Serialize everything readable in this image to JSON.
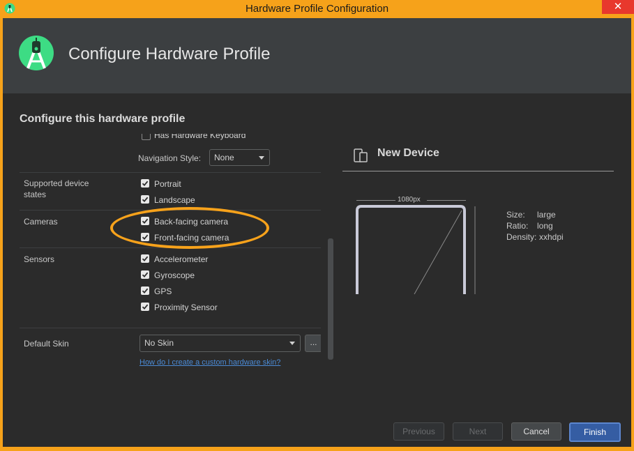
{
  "window": {
    "title": "Hardware Profile Configuration",
    "close_glyph": "✕"
  },
  "header": {
    "title": "Configure Hardware Profile"
  },
  "section": {
    "title": "Configure this hardware profile"
  },
  "form": {
    "has_keyboard": {
      "label": "Has Hardware Keyboard",
      "checked": false
    },
    "navigation_style": {
      "label": "Navigation Style:",
      "value": "None"
    },
    "device_states": {
      "label": "Supported device states",
      "items": [
        {
          "label": "Portrait",
          "checked": true
        },
        {
          "label": "Landscape",
          "checked": true
        }
      ]
    },
    "cameras": {
      "label": "Cameras",
      "items": [
        {
          "label": "Back-facing camera",
          "checked": true
        },
        {
          "label": "Front-facing camera",
          "checked": true
        }
      ]
    },
    "sensors": {
      "label": "Sensors",
      "items": [
        {
          "label": "Accelerometer",
          "checked": true
        },
        {
          "label": "Gyroscope",
          "checked": true
        },
        {
          "label": "GPS",
          "checked": true
        },
        {
          "label": "Proximity Sensor",
          "checked": true
        }
      ]
    },
    "default_skin": {
      "label": "Default Skin",
      "value": "No Skin",
      "more_label": "...",
      "help_link": "How do I create a custom hardware skin?"
    }
  },
  "preview": {
    "title": "New Device",
    "width_label": "1080px",
    "specs": [
      {
        "label": "Size:",
        "value": "large"
      },
      {
        "label": "Ratio:",
        "value": "long"
      },
      {
        "label": "Density:",
        "value": "xxhdpi"
      }
    ]
  },
  "buttons": {
    "previous": "Previous",
    "next": "Next",
    "cancel": "Cancel",
    "finish": "Finish"
  },
  "colors": {
    "accent": "#355da3",
    "highlight": "#f7a21b",
    "titlebar": "#f6a21a"
  }
}
